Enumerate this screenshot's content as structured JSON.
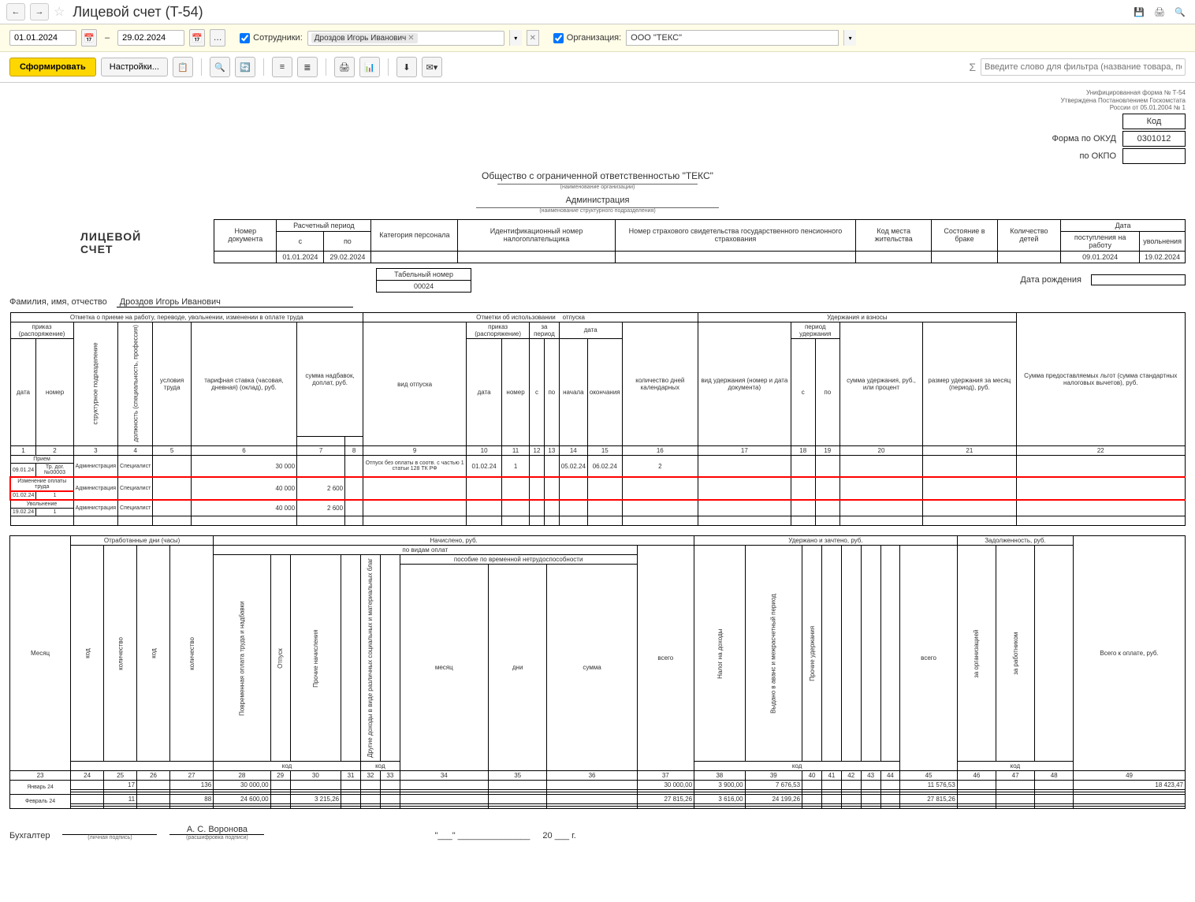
{
  "header": {
    "title": "Лицевой счет (T-54)"
  },
  "filters": {
    "date_from": "01.01.2024",
    "date_to": "29.02.2024",
    "employees_label": "Сотрудники:",
    "employee_tag": "Дроздов Игорь Иванович",
    "org_label": "Организация:",
    "org_value": "ООО \"ТЕКС\""
  },
  "actions": {
    "form": "Сформировать",
    "settings": "Настройки...",
    "filter_placeholder": "Введите слово для фильтра (название товара, покупателя и"
  },
  "report": {
    "form_meta1": "Унифицированная форма № Т-54",
    "form_meta2": "Утверждена Постановлением Госкомстата",
    "form_meta3": "России от 05.01.2004 № 1",
    "code_label": "Код",
    "okud_label": "Форма по ОКУД",
    "okud": "0301012",
    "okpo_label": "по ОКПО",
    "org_full": "Общество с ограниченной ответственностью \"ТЕКС\"",
    "org_sub": "(наименование организации)",
    "dept": "Администрация",
    "dept_sub": "(наименование структурного подразделения)",
    "doc_no_label": "Номер документа",
    "period_label": "Расчетный период",
    "period_from_h": "с",
    "period_to_h": "по",
    "period_from": "01.01.2024",
    "period_to": "29.02.2024",
    "cat_label": "Категория персонала",
    "inn_label": "Идентификационный номер налогоплательщика",
    "snils_label": "Номер страхового свидетельства государственного пенсионного страхования",
    "addr_label": "Код места жительства",
    "marital_label": "Состояние в браке",
    "children_label": "Количество детей",
    "date_label": "Дата",
    "hire_label": "поступления на работу",
    "fire_label": "увольнения",
    "hire_date": "09.01.2024",
    "fire_date": "19.02.2024",
    "doc_title": "ЛИЦЕВОЙ СЧЕТ",
    "tab_no_label": "Табельный номер",
    "tab_no": "00024",
    "dob_label": "Дата рождения",
    "fio_label": "Фамилия, имя, отчество",
    "fio": "Дроздов Игорь Иванович",
    "sec1": "Отметка о приеме на работу, переводе, увольнении, изменении в оплате труда",
    "sec2": "Отметки об использовании",
    "sec2b": "отпуска",
    "sec3": "Удержания и взносы",
    "sec4": "Сумма предоставляемых льгот (сумма стандартных налоговых вычетов), руб.",
    "h_order": "приказ (распоряжение)",
    "h_dept": "структурное подразделение",
    "h_job": "должность (специальность, профессия)",
    "h_cond": "условия труда",
    "h_rate": "тарифная ставка (часовая, дневная) (оклад), руб.",
    "h_allow": "сумма надбавок, доплат, руб.",
    "h_vac_type": "вид отпуска",
    "h_for_period": "за период",
    "h_date2": "дата",
    "h_days": "количество дней календарных",
    "h_ded_type": "вид удержания (номер и дата документа)",
    "h_ded_period": "период удержания",
    "h_ded_sum": "сумма удержания, руб., или процент",
    "h_ded_month": "размер удержания за месяц (период), руб.",
    "h_date_s": "дата",
    "h_no_s": "номер",
    "h_from_s": "с",
    "h_to_s": "по",
    "h_start": "начала",
    "h_end": "окончания",
    "rows": {
      "r1": {
        "type": "Прием",
        "date": "09.01.24",
        "no": "Тр. дог. №00003",
        "dept": "Администрация",
        "job": "Специалист",
        "rate": "30 000",
        "vac": "Отпуск без оплаты в соотв. с частью 1 статьи 128 ТК РФ",
        "o_date": "01.02.24",
        "o_no": "1",
        "d_start": "05.02.24",
        "d_end": "06.02.24",
        "days": "2"
      },
      "r2": {
        "type": "Изменение оплаты труда",
        "date": "01.02.24",
        "no": "1",
        "dept": "Администрация",
        "job": "Специалист",
        "rate": "40 000",
        "allow": "2 600"
      },
      "r3": {
        "type": "Увольнение",
        "date": "19.02.24",
        "no": "1",
        "dept": "Администрация",
        "job": "Специалист",
        "rate": "40 000",
        "allow": "2 600"
      }
    },
    "sec_worked": "Отработанные дни (часы)",
    "sec_accrued": "Начислено, руб.",
    "sec_withheld": "Удержано и зачтено, руб.",
    "sec_debt": "Задолженность, руб.",
    "h_month": "Месяц",
    "h_by_pay": "по видам оплат",
    "h_code": "код",
    "h_qty": "количество",
    "h_timepay": "Повременная оплата труда и надбавки",
    "h_vacation": "Отпуск",
    "h_other_acc": "Прочие начисления",
    "h_other_inc": "Другие доходы в виде различных социальных и материальных благ",
    "h_sick": "пособие по временной нетрудоспособности",
    "h_total": "всего",
    "h_tax": "Налог на доходы",
    "h_advance": "Выдано в аванс и межрасчетный период",
    "h_other_ded": "Прочие удержания",
    "h_debt_org": "за организацией",
    "h_debt_emp": "за работником",
    "h_to_pay": "Всего к оплате, руб.",
    "h_mon": "месяц",
    "h_days2": "дни",
    "h_sum": "сумма",
    "months": {
      "m1": {
        "name": "Январь 24",
        "code1": "17",
        "qty1": "",
        "qty2": "136",
        "timepay": "30 000,00",
        "total": "30 000,00",
        "tax": "3 900,00",
        "adv": "7 676,53",
        "withheld": "11 576,53",
        "topay": "18 423,47"
      },
      "m2": {
        "name": "Февраль 24",
        "code1": "11",
        "qty2": "88",
        "timepay": "24 600,00",
        "other": "3 215,26",
        "total": "27 815,26",
        "tax": "3 616,00",
        "adv": "24 199,26",
        "withheld": "27 815,26"
      }
    },
    "footer": {
      "label": "Бухгалтер",
      "sig_sub1": "(личная подпись)",
      "name": "А. С. Воронова",
      "sig_sub2": "(расшифровка подписи)",
      "year_suffix": "20 ___ г.",
      "quotes": "\"___\" _______________"
    }
  }
}
